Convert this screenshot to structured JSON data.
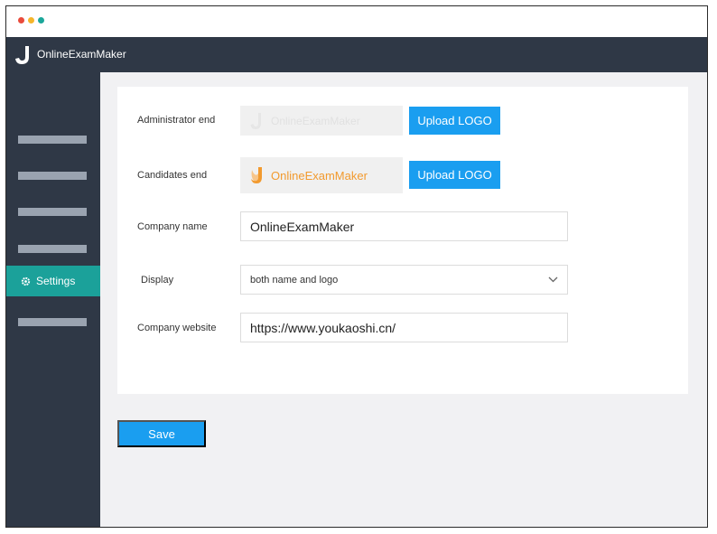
{
  "window": {
    "dots": [
      "#e94b3c",
      "#f5b52a",
      "#1ba79a"
    ]
  },
  "app": {
    "brand_name": "OnlineExamMaker"
  },
  "sidebar": {
    "active_item": {
      "label": "Settings",
      "icon": "gear-icon"
    }
  },
  "form": {
    "admin": {
      "label": "Administrator end",
      "logo_text": "OnlineExamMaker",
      "upload_label": "Upload LOGO"
    },
    "candidates": {
      "label": "Candidates end",
      "logo_text": "OnlineExamMaker",
      "upload_label": "Upload LOGO"
    },
    "company_name": {
      "label": "Company name",
      "value": "OnlineExamMaker"
    },
    "display": {
      "label": "Display",
      "selected": "both name and logo"
    },
    "company_website": {
      "label": "Company website",
      "value": "https://www.youkaoshi.cn/"
    },
    "save_label": "Save"
  },
  "colors": {
    "accent": "#1a9ef0",
    "sidebar": "#2f3846",
    "active": "#1ba19a",
    "brand_orange": "#f29a2e"
  }
}
